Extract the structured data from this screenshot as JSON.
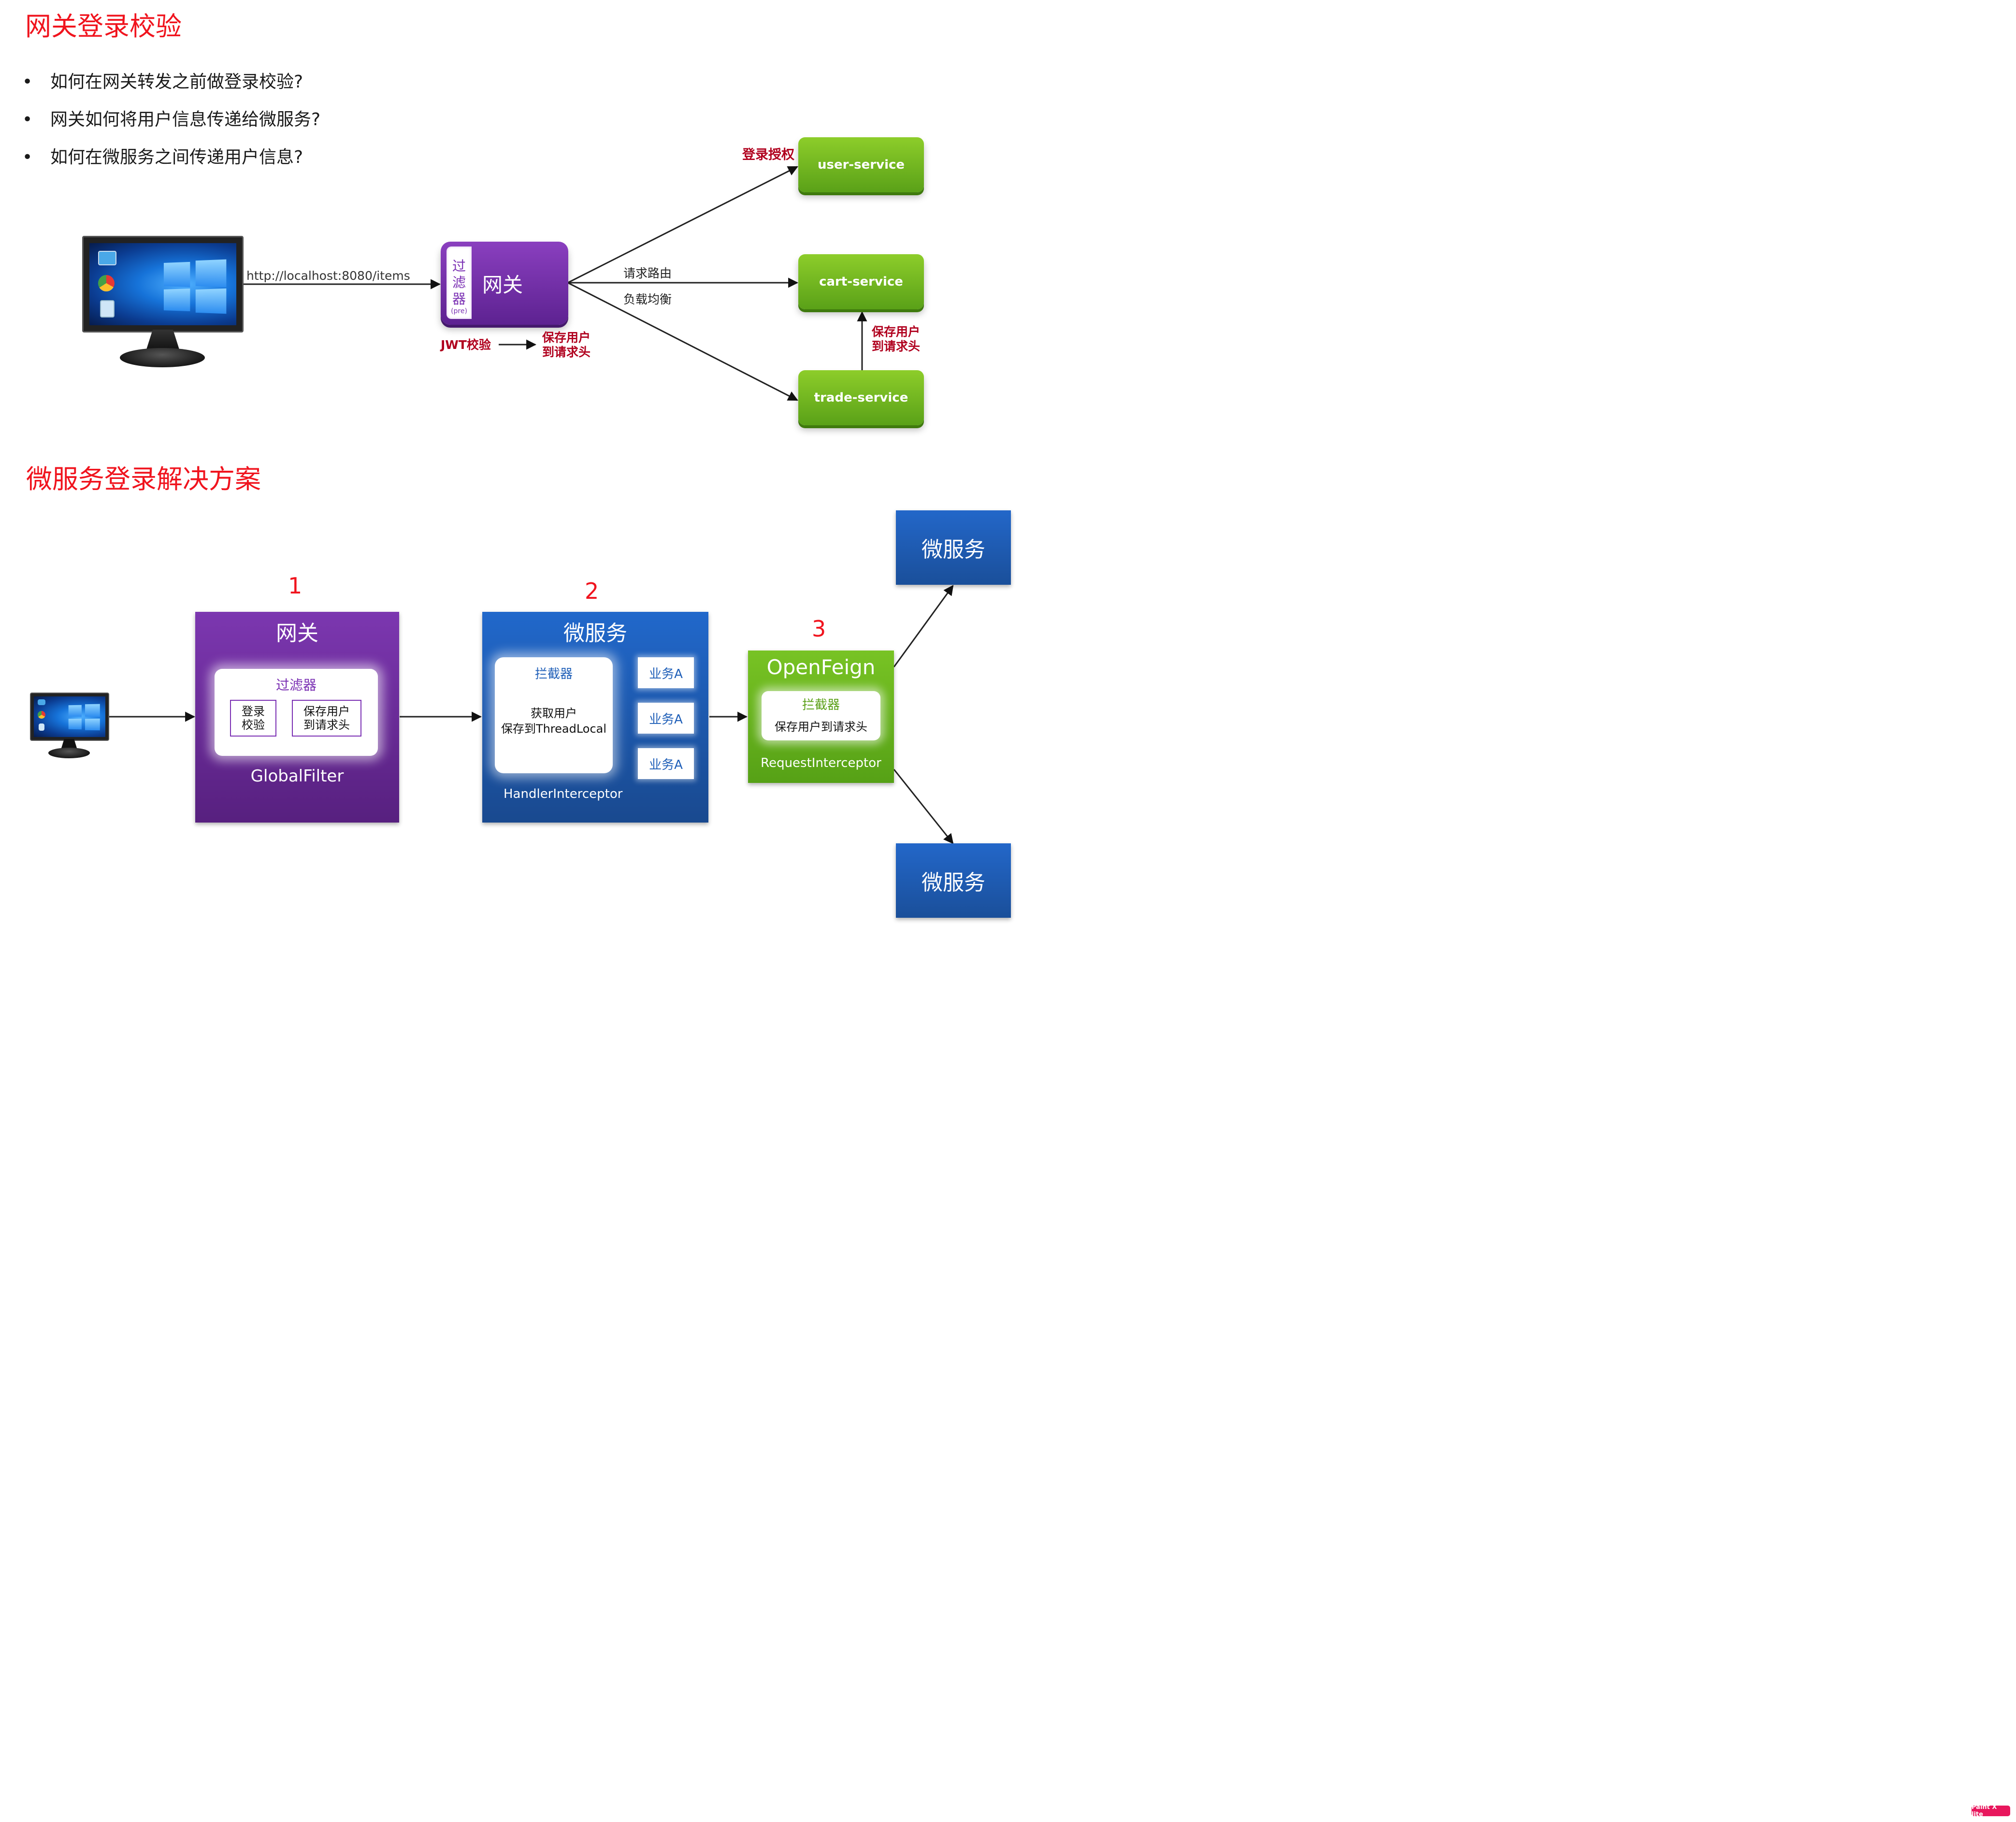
{
  "section1": {
    "title": "网关登录校验",
    "bullets": [
      "如何在网关转发之前做登录校验?",
      "网关如何将用户信息传递给微服务?",
      "如何在微服务之间传递用户信息?"
    ]
  },
  "diagram1": {
    "url_label": "http://localhost:8080/items",
    "filter_label": "过滤器",
    "filter_pre": "(pre)",
    "gateway_label": "网关",
    "jwt_label": "JWT校验",
    "save_user_label": "保存用户\n到请求头",
    "route_label": "请求路由",
    "lb_label": "负载均衡",
    "login_auth_label": "登录授权",
    "save_user_label_2": "保存用户\n到请求头",
    "services": {
      "user": "user-service",
      "cart": "cart-service",
      "trade": "trade-service"
    }
  },
  "section2": {
    "title": "微服务登录解决方案"
  },
  "diagram2": {
    "step1": "1",
    "step2": "2",
    "step3": "3",
    "gateway": {
      "title": "网关",
      "filter_title": "过滤器",
      "login_check": "登录\n校验",
      "save_user": "保存用户\n到请求头",
      "footer": "GlobalFilter"
    },
    "microservice": {
      "title": "微服务",
      "interceptor_title": "拦截器",
      "interceptor_body": "获取用户\n保存到ThreadLocal",
      "business": [
        "业务A",
        "业务A",
        "业务A"
      ],
      "footer": "HandlerInterceptor"
    },
    "openfeign": {
      "title": "OpenFeign",
      "interceptor_title": "拦截器",
      "interceptor_body": "保存用户到请求头",
      "footer": "RequestInterceptor"
    },
    "targets": [
      "微服务",
      "微服务"
    ]
  },
  "watermark": "Paint X lite",
  "colors": {
    "title_red": "#f0141e",
    "dark_red": "#b0001e",
    "purple": "#6c2e9c",
    "green": "#6fb81f",
    "blue": "#1f5fb8"
  }
}
